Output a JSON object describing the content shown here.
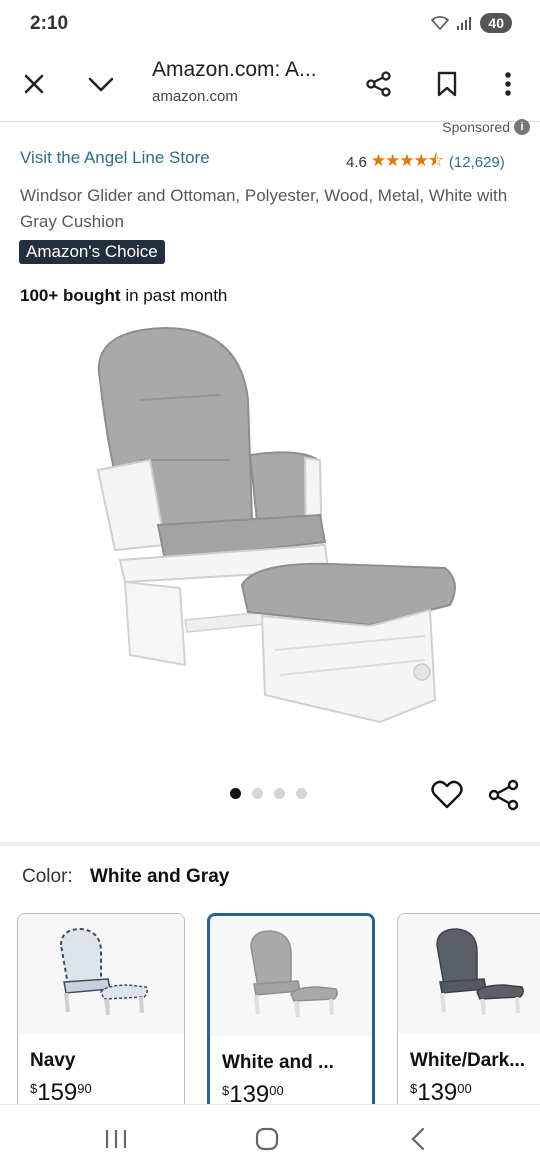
{
  "status": {
    "time": "2:10",
    "battery": "40"
  },
  "browser": {
    "tab_title": "Amazon.com: A...",
    "url": "amazon.com"
  },
  "product": {
    "sponsored": "Sponsored",
    "store_link": "Visit the Angel Line Store",
    "rating": "4.6",
    "stars": "★★★★⯪",
    "rating_count": "(12,629)",
    "title": "Windsor Glider and Ottoman, Polyester, Wood, Metal, White with Gray Cushion",
    "badge": "Amazon's Choice",
    "bought_bold": "100+ bought",
    "bought_rest": " in past month"
  },
  "carousel": {
    "total": 4,
    "active": 0
  },
  "color": {
    "label": "Color:",
    "value": "White and Gray"
  },
  "swatches": [
    {
      "name": "Navy",
      "price_main": "159",
      "price_cents": "90",
      "currency": "$"
    },
    {
      "name": "White and ...",
      "price_main": "139",
      "price_cents": "00",
      "currency": "$"
    },
    {
      "name": "White/Dark...",
      "price_main": "139",
      "price_cents": "00",
      "currency": "$"
    }
  ],
  "colors": {
    "link": "#2a6f8f",
    "star": "#e77600",
    "badge_bg": "#232f3e",
    "selected_border": "#2162a1"
  }
}
